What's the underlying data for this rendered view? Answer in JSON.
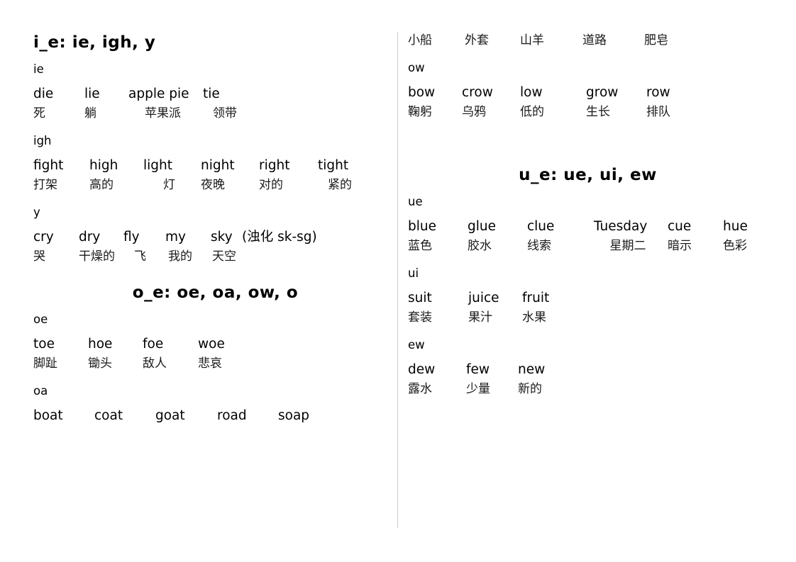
{
  "document": {
    "title": "Phonics word list: long vowel spellings with Chinese glosses"
  },
  "left_column": {
    "heading_ie": "i_e: ie, igh, y",
    "tag_ie": "ie",
    "ie_words": [
      "die",
      "lie",
      "apple pie",
      "tie"
    ],
    "ie_gloss": [
      "死",
      "躺",
      "苹果派",
      "领带"
    ],
    "tag_igh": "igh",
    "igh_words": [
      "fight",
      "high",
      "light",
      "night",
      "right",
      "tight"
    ],
    "igh_gloss": [
      "打架",
      "高的",
      "灯",
      "夜晚",
      "对的",
      "紧的"
    ],
    "tag_y": "y",
    "y_words": [
      "cry",
      "dry",
      "fly",
      "my",
      "sky"
    ],
    "y_note": "(浊化 sk-sg)",
    "y_gloss": [
      "哭",
      "干燥的",
      "飞",
      "我的",
      "天空"
    ],
    "heading_oe": "o_e: oe, oa, ow, o",
    "tag_oe": "oe",
    "oe_words": [
      "toe",
      "hoe",
      "foe",
      "woe"
    ],
    "oe_gloss": [
      "脚趾",
      "锄头",
      "敌人",
      "悲哀"
    ],
    "tag_oa": "oa",
    "oa_words": [
      "boat",
      "coat",
      "goat",
      "road",
      "soap"
    ]
  },
  "right_column": {
    "oa_gloss": [
      "小船",
      "外套",
      "山羊",
      "道路",
      "肥皂"
    ],
    "tag_ow": "ow",
    "ow_words": [
      "bow",
      "crow",
      "low",
      "grow",
      "row"
    ],
    "ow_gloss": [
      "鞠躬",
      "乌鸦",
      "低的",
      "生长",
      "排队"
    ],
    "heading_ue": "u_e: ue, ui, ew",
    "tag_ue": "ue",
    "ue_words": [
      "blue",
      "glue",
      "clue",
      "Tuesday",
      "cue",
      "hue"
    ],
    "ue_gloss": [
      "蓝色",
      "胶水",
      "线索",
      "星期二",
      "暗示",
      "色彩"
    ],
    "tag_ui": "ui",
    "ui_words": [
      "suit",
      "juice",
      "fruit"
    ],
    "ui_gloss": [
      "套装",
      "果汁",
      "水果"
    ],
    "tag_ew": "ew",
    "ew_words": [
      "dew",
      "few",
      "new"
    ],
    "ew_gloss": [
      "露水",
      "少量",
      "新的"
    ]
  }
}
